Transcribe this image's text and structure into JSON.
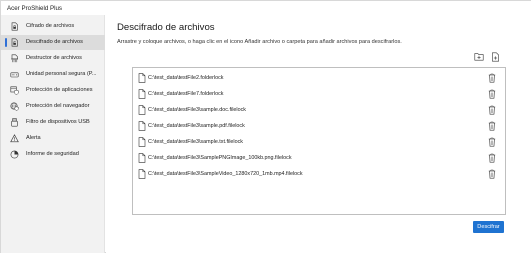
{
  "app": {
    "title": "Acer ProShield Plus"
  },
  "sidebar": {
    "items": [
      {
        "label": "Cifrado de archivos",
        "icon": "file-lock-icon",
        "active": false
      },
      {
        "label": "Descifrado de archivos",
        "icon": "file-unlock-icon",
        "active": true
      },
      {
        "label": "Destructor de archivos",
        "icon": "shredder-icon",
        "active": false
      },
      {
        "label": "Unidad personal segura (P...",
        "icon": "secure-drive-icon",
        "active": false
      },
      {
        "label": "Protección de aplicaciones",
        "icon": "app-shield-icon",
        "active": false
      },
      {
        "label": "Protección del navegador",
        "icon": "browser-shield-icon",
        "active": false
      },
      {
        "label": "Filtro de dispositivos USB",
        "icon": "usb-icon",
        "active": false
      },
      {
        "label": "Alerta",
        "icon": "warning-icon",
        "active": false
      },
      {
        "label": "Informe de seguridad",
        "icon": "report-icon",
        "active": false
      }
    ]
  },
  "main": {
    "title": "Descifrado de archivos",
    "description": "Arrastre y coloque archivos, o haga clic en el icono Añadir archivo o carpeta para añadir archivos para descifrarlos.",
    "add_folder_icon": "add-folder-icon",
    "add_file_icon": "add-file-icon",
    "files": [
      "C:\\test_data\\testFile2.folderlock",
      "C:\\test_data\\testFile7.folderlock",
      "C:\\test_data\\testFile3\\sample.doc.filelock",
      "C:\\test_data\\testFile3\\sample.pdf.filelock",
      "C:\\test_data\\testFile3\\sample.txt.filelock",
      "C:\\test_data\\testFile3\\SamplePNGImage_100kb.png.filelock",
      "C:\\test_data\\testFile3\\SampleVideo_1280x720_1mb.mp4.filelock"
    ],
    "primary_button": "Descifrar"
  },
  "colors": {
    "accent": "#1f73d1",
    "sidebar_bg": "#f2f2f2",
    "active_bg": "#dcdcdc"
  }
}
